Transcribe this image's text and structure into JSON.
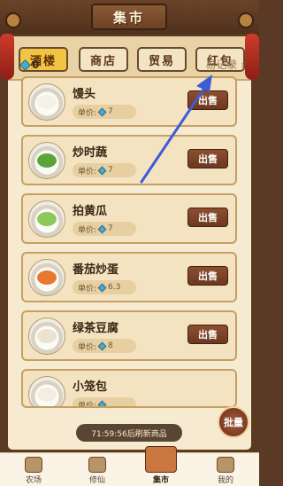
{
  "header": {
    "title": "集市"
  },
  "tabs": [
    {
      "label": "酒楼",
      "active": true
    },
    {
      "label": "商店",
      "active": false
    },
    {
      "label": "贸易",
      "active": false
    },
    {
      "label": "红包",
      "active": false
    }
  ],
  "currency": {
    "icon": "gem-icon",
    "amount": "0"
  },
  "records_link": "易记录 ›",
  "price_label": "单价:",
  "sell_label": "出售",
  "items": [
    {
      "name": "馒头",
      "price": "7",
      "food_color": "#f6f1e6"
    },
    {
      "name": "炒时蔬",
      "price": "7",
      "food_color": "#5aa43a"
    },
    {
      "name": "拍黄瓜",
      "price": "7",
      "food_color": "#8cc85a"
    },
    {
      "name": "番茄炒蛋",
      "price": "6.3",
      "food_color": "#e8772f"
    },
    {
      "name": "绿茶豆腐",
      "price": "8",
      "food_color": "#eae3cf"
    },
    {
      "name": "小笼包",
      "price": "",
      "food_color": "#f3eee1"
    }
  ],
  "timer_text": "71:59:56后刷新商品",
  "batch_label": "批量",
  "bottom_nav": [
    {
      "label": "农场",
      "icon": "farm-icon",
      "active": false
    },
    {
      "label": "修仙",
      "icon": "cultivate-icon",
      "active": false
    },
    {
      "label": "集市",
      "icon": "market-icon",
      "active": true
    },
    {
      "label": "我的",
      "icon": "profile-icon",
      "active": false
    }
  ],
  "annotation": {
    "color": "#3e5bd8"
  }
}
